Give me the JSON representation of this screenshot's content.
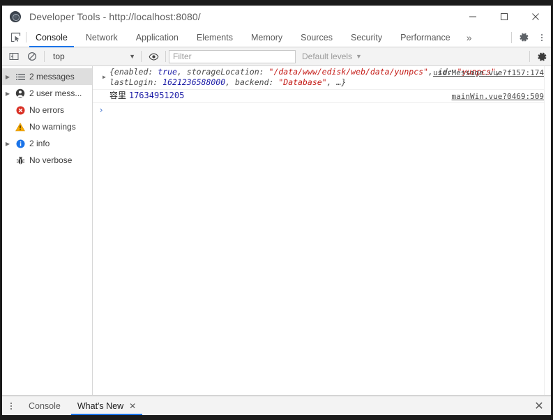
{
  "window": {
    "title": "Developer Tools - http://localhost:8080/",
    "app_icon": "devtools-gear-icon",
    "minimize_label": "Minimize",
    "maximize_label": "Maximize",
    "close_label": "Close"
  },
  "tabbar": {
    "inspect_icon": "inspect-element-icon",
    "tabs": [
      {
        "label": "Console",
        "active": true
      },
      {
        "label": "Network",
        "active": false
      },
      {
        "label": "Application",
        "active": false
      },
      {
        "label": "Elements",
        "active": false
      },
      {
        "label": "Memory",
        "active": false
      },
      {
        "label": "Sources",
        "active": false
      },
      {
        "label": "Security",
        "active": false
      },
      {
        "label": "Performance",
        "active": false
      }
    ],
    "more_label": "»",
    "settings_icon": "gear-icon",
    "menu_icon": "kebab-menu-icon"
  },
  "filterbar": {
    "sidebar_toggle_icon": "show-console-sidebar-icon",
    "clear_icon": "clear-console-icon",
    "context_value": "top",
    "context_caret": "▼",
    "eye_icon": "live-expression-eye-icon",
    "filter_placeholder": "Filter",
    "filter_value": "",
    "levels_label": "Default levels",
    "levels_caret": "▼",
    "settings_icon": "console-settings-gear-icon"
  },
  "sidebar": {
    "items": [
      {
        "label": "2 messages",
        "icon": "list-icon",
        "arrow": "▶",
        "has_arrow": true,
        "selected": true
      },
      {
        "label": "2 user mess...",
        "icon": "user-icon",
        "arrow": "▶",
        "has_arrow": true,
        "selected": false
      },
      {
        "label": "No errors",
        "icon": "error-icon",
        "arrow": "",
        "has_arrow": false,
        "selected": false
      },
      {
        "label": "No warnings",
        "icon": "warning-icon",
        "arrow": "",
        "has_arrow": false,
        "selected": false
      },
      {
        "label": "2 info",
        "icon": "info-icon",
        "arrow": "▶",
        "has_arrow": true,
        "selected": false
      },
      {
        "label": "No verbose",
        "icon": "bug-icon",
        "arrow": "",
        "has_arrow": false,
        "selected": false
      }
    ]
  },
  "console": {
    "messages": [
      {
        "type": "object",
        "expand_arrow": "▶",
        "source": "userMessage.vue?f157:174",
        "tokens": [
          {
            "t": "key",
            "v": "{enabled: "
          },
          {
            "t": "bool",
            "v": "true"
          },
          {
            "t": "key",
            "v": ", storageLocation: "
          },
          {
            "t": "str",
            "v": "\"/data/www/edisk/web/data/yunpcs\""
          },
          {
            "t": "key",
            "v": ", id: "
          },
          {
            "t": "str",
            "v": "\"yunpcs\""
          },
          {
            "t": "key",
            "v": ", lastLogin: "
          },
          {
            "t": "num",
            "v": "1621236588000"
          },
          {
            "t": "key",
            "v": ", backend: "
          },
          {
            "t": "str",
            "v": "\"Database\""
          },
          {
            "t": "key",
            "v": ", …}"
          }
        ]
      },
      {
        "type": "plain",
        "label": "容里",
        "value": "17634951205",
        "source": "mainWin.vue?0469:509"
      }
    ],
    "prompt_caret": "›",
    "prompt_value": ""
  },
  "drawer": {
    "menu_icon": "kebab-menu-icon",
    "tabs": [
      {
        "label": "Console",
        "active": false,
        "closable": false
      },
      {
        "label": "What's New",
        "active": true,
        "closable": true,
        "close_label": "✕"
      }
    ],
    "close_label": "✕"
  },
  "colors": {
    "accent": "#1a73e8",
    "error": "#d93025",
    "warning": "#f9ab00",
    "info": "#1a73e8",
    "string": "#c41a16",
    "number": "#1a1aa6"
  }
}
